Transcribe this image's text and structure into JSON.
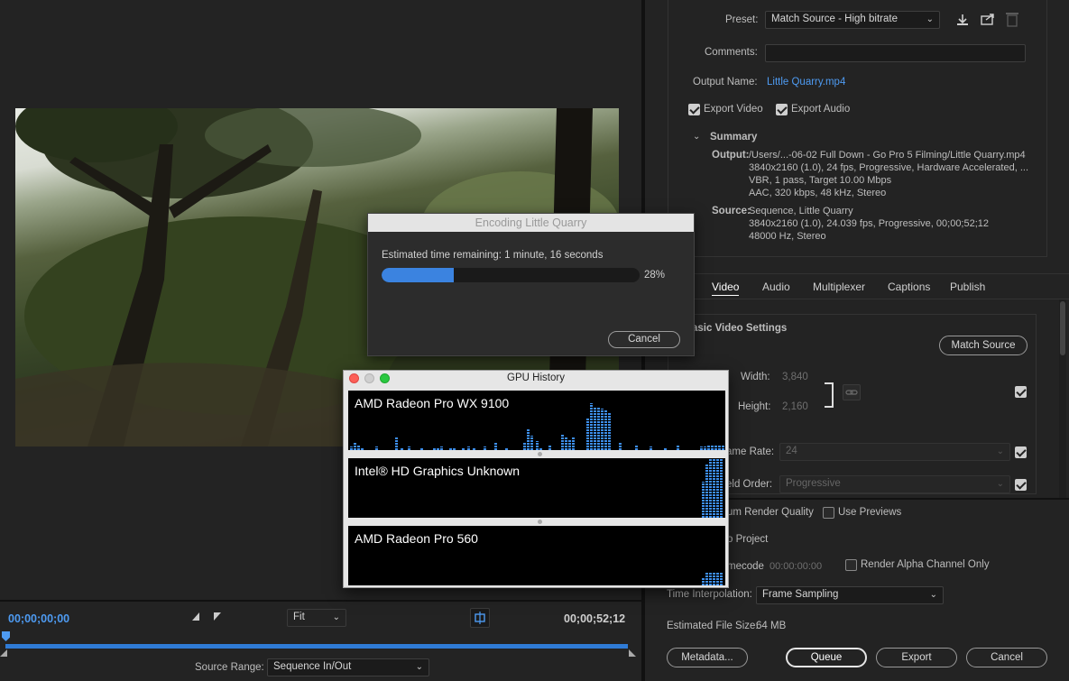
{
  "export": {
    "preset_label": "Preset:",
    "preset_value": "Match Source - High bitrate",
    "comments_label": "Comments:",
    "comments_value": "",
    "output_name_label": "Output Name:",
    "output_name_value": "Little Quarry.mp4",
    "export_video_label": "Export Video",
    "export_video_checked": true,
    "export_audio_label": "Export Audio",
    "export_audio_checked": true
  },
  "summary": {
    "title": "Summary",
    "output_label": "Output:",
    "output_lines": [
      "/Users/...-06-02 Full Down - Go Pro 5 Filming/Little Quarry.mp4",
      "3840x2160 (1.0), 24 fps, Progressive, Hardware Accelerated, ...",
      "VBR, 1 pass, Target 10.00 Mbps",
      "AAC, 320 kbps, 48 kHz, Stereo"
    ],
    "source_label": "Source:",
    "source_lines": [
      "Sequence, Little Quarry",
      "3840x2160 (1.0), 24.039 fps, Progressive, 00;00;52;12",
      "48000 Hz, Stereo"
    ]
  },
  "tabs": [
    "Video",
    "Audio",
    "Multiplexer",
    "Captions",
    "Publish"
  ],
  "video_settings": {
    "section_title": "asic Video Settings",
    "match_source_button": "Match Source",
    "width_label": "Width:",
    "width_value": "3,840",
    "height_label": "Height:",
    "height_value": "2,160",
    "frame_rate_label": "ame Rate:",
    "frame_rate_value": "24",
    "field_order_label": "eld Order:",
    "field_order_value": "Progressive"
  },
  "bottom": {
    "max_render_label": "um Render Quality",
    "use_previews_label": "Use Previews",
    "import_project_label": "o Project",
    "timecode_label": "mecode",
    "timecode_value": "00:00:00:00",
    "render_alpha_label": "Render Alpha Channel Only",
    "time_interp_label": "Time Interpolation:",
    "time_interp_value": "Frame Sampling",
    "est_size_label": "Estimated File Size:",
    "est_size_value": "64 MB",
    "metadata_button": "Metadata...",
    "queue_button": "Queue",
    "export_button": "Export",
    "cancel_button": "Cancel"
  },
  "encoding": {
    "title": "Encoding Little Quarry",
    "remaining": "Estimated time remaining: 1 minute, 16 seconds",
    "percent_label": "28%",
    "progress": 0.28,
    "cancel_button": "Cancel"
  },
  "gpu_history": {
    "title": "GPU History",
    "gpus": [
      "AMD Radeon Pro WX 9100",
      "Intel® HD Graphics Unknown",
      "AMD Radeon Pro 560"
    ]
  },
  "timeline": {
    "current_tc": "00;00;00;00",
    "end_tc": "00;00;52;12",
    "zoom_value": "Fit",
    "source_range_label": "Source Range:",
    "source_range_value": "Sequence In/Out"
  },
  "colors": {
    "accent": "#4e9bf2",
    "progress": "#3b83e0",
    "gpu_bar": "#3d8eea"
  },
  "icons": [
    "save-preset-icon",
    "import-preset-icon",
    "delete-preset-icon",
    "link-icon",
    "mark-in-icon",
    "mark-out-icon",
    "fit-to-frame-icon",
    "playhead-icon"
  ]
}
